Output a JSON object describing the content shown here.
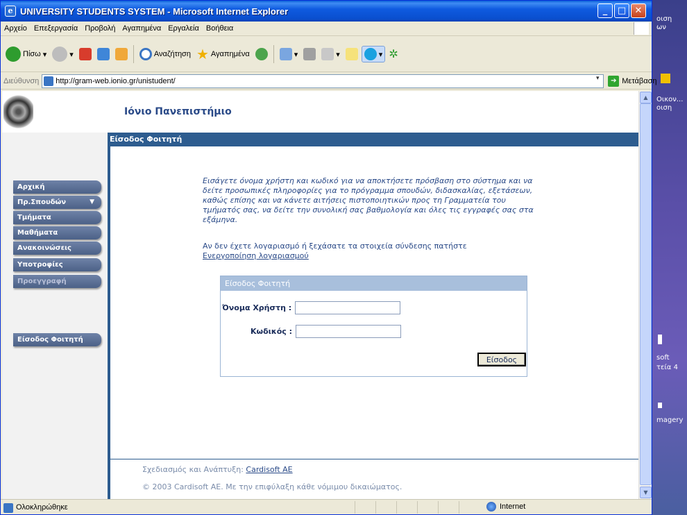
{
  "window": {
    "title": "UNIVERSITY STUDENTS SYSTEM - Microsoft Internet Explorer"
  },
  "menu": [
    "Αρχείο",
    "Επεξεργασία",
    "Προβολή",
    "Αγαπημένα",
    "Εργαλεία",
    "Βοήθεια"
  ],
  "toolbar": {
    "back_label": "Πίσω",
    "search_label": "Αναζήτηση",
    "favorites_label": "Αγαπημένα"
  },
  "address": {
    "label": "Διεύθυνση",
    "url": "http://gram-web.ionio.gr/unistudent/",
    "go_label": "Μετάβαση"
  },
  "page": {
    "university": "Ιόνιο Πανεπιστήμιο",
    "section_header": "Είσοδος Φοιτητή",
    "nav": [
      {
        "label": "Αρχική"
      },
      {
        "label": "Πρ.Σπουδών",
        "arrow": "▼"
      },
      {
        "label": "Τμήματα"
      },
      {
        "label": "Μαθήματα"
      },
      {
        "label": "Ανακοινώσεις"
      },
      {
        "label": "Υποτροφίες"
      },
      {
        "label": "Προεγγραφή"
      }
    ],
    "nav_login": "Είσοδος Φοιτητή",
    "intro": "Εισάγετε όνομα χρήστη και κωδικό για να αποκτήσετε πρόσβαση στο σύστημα και να δείτε προσωπικές πληροφορίες για το πρόγραμμα σπουδών, διδασκαλίας, εξετάσεων, καθώς επίσης και να κάνετε αιτήσεις πιστοποιητικών προς τη Γραμματεία του τμήματός σας, να δείτε την συνολική σας βαθμολογία και όλες τις εγγραφές σας στα εξάμηνα.",
    "note": "Αν δεν έχετε λογαριασμό ή ξεχάσατε τα στοιχεία σύνδεσης πατήστε",
    "activation_link": "Ενεργοποίηση λογαριασμού",
    "login": {
      "title": "Είσοδος Φοιτητή",
      "username_label": "Όνομα Χρήστη :",
      "password_label": "Κωδικός :",
      "username_value": "",
      "password_value": "",
      "submit": "Είσοδος"
    },
    "footer": {
      "design_prefix": "Σχεδιασμός και Ανάπτυξη:",
      "design_link": "Cardisoft AE",
      "copyright": "© 2003 Cardisoft AE. Με την επιφύλαξη κάθε νόμιμου δικαιώματος."
    }
  },
  "status": {
    "text": "Ολοκληρώθηκε",
    "zone": "Internet"
  },
  "desktop": [
    "οιση",
    "ων",
    "Οικον...",
    "οιση",
    "soft",
    "τεία 4",
    "magery"
  ],
  "colors": {
    "title_blue": "#0a4fcf",
    "header_blue": "#2d5c8f",
    "nav_btn": "#5a6e94",
    "text_blue": "#2a4a88"
  }
}
